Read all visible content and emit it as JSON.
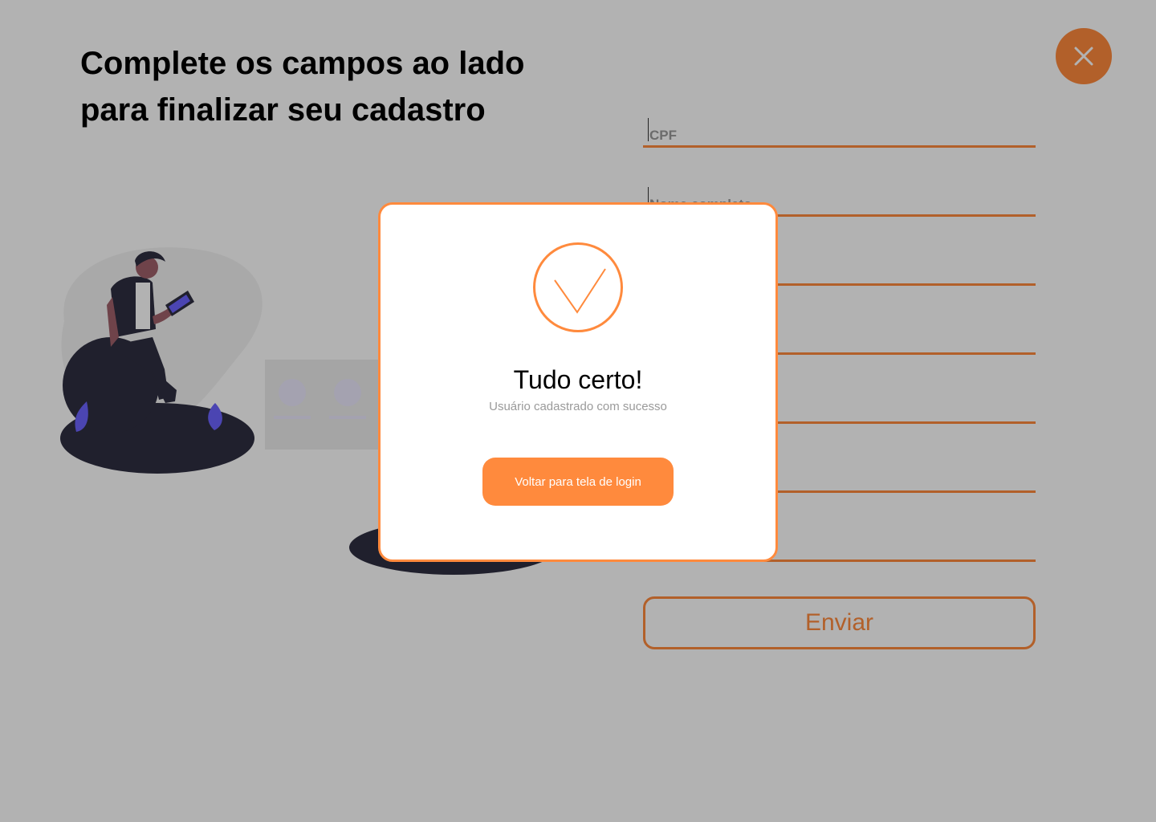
{
  "page": {
    "heading": "Complete os campos ao lado para finalizar seu cadastro",
    "accent_color": "#ff8a3d",
    "overlay_color": "rgba(0,0,0,0.30)"
  },
  "form": {
    "fields": [
      {
        "placeholder": "CPF",
        "value": ""
      },
      {
        "placeholder": "Nome completo",
        "value": ""
      },
      {
        "placeholder": "",
        "value": ""
      },
      {
        "placeholder": "",
        "value": ""
      },
      {
        "placeholder": "",
        "value": ""
      },
      {
        "placeholder": "",
        "value": ""
      },
      {
        "placeholder": "",
        "value": ""
      }
    ],
    "submit_label": "Enviar"
  },
  "close_button": {
    "icon": "close-icon"
  },
  "modal": {
    "icon": "checkmark-icon",
    "title": "Tudo certo!",
    "subtitle": "Usuário cadastrado com sucesso",
    "button_label": "Voltar para tela de login"
  }
}
